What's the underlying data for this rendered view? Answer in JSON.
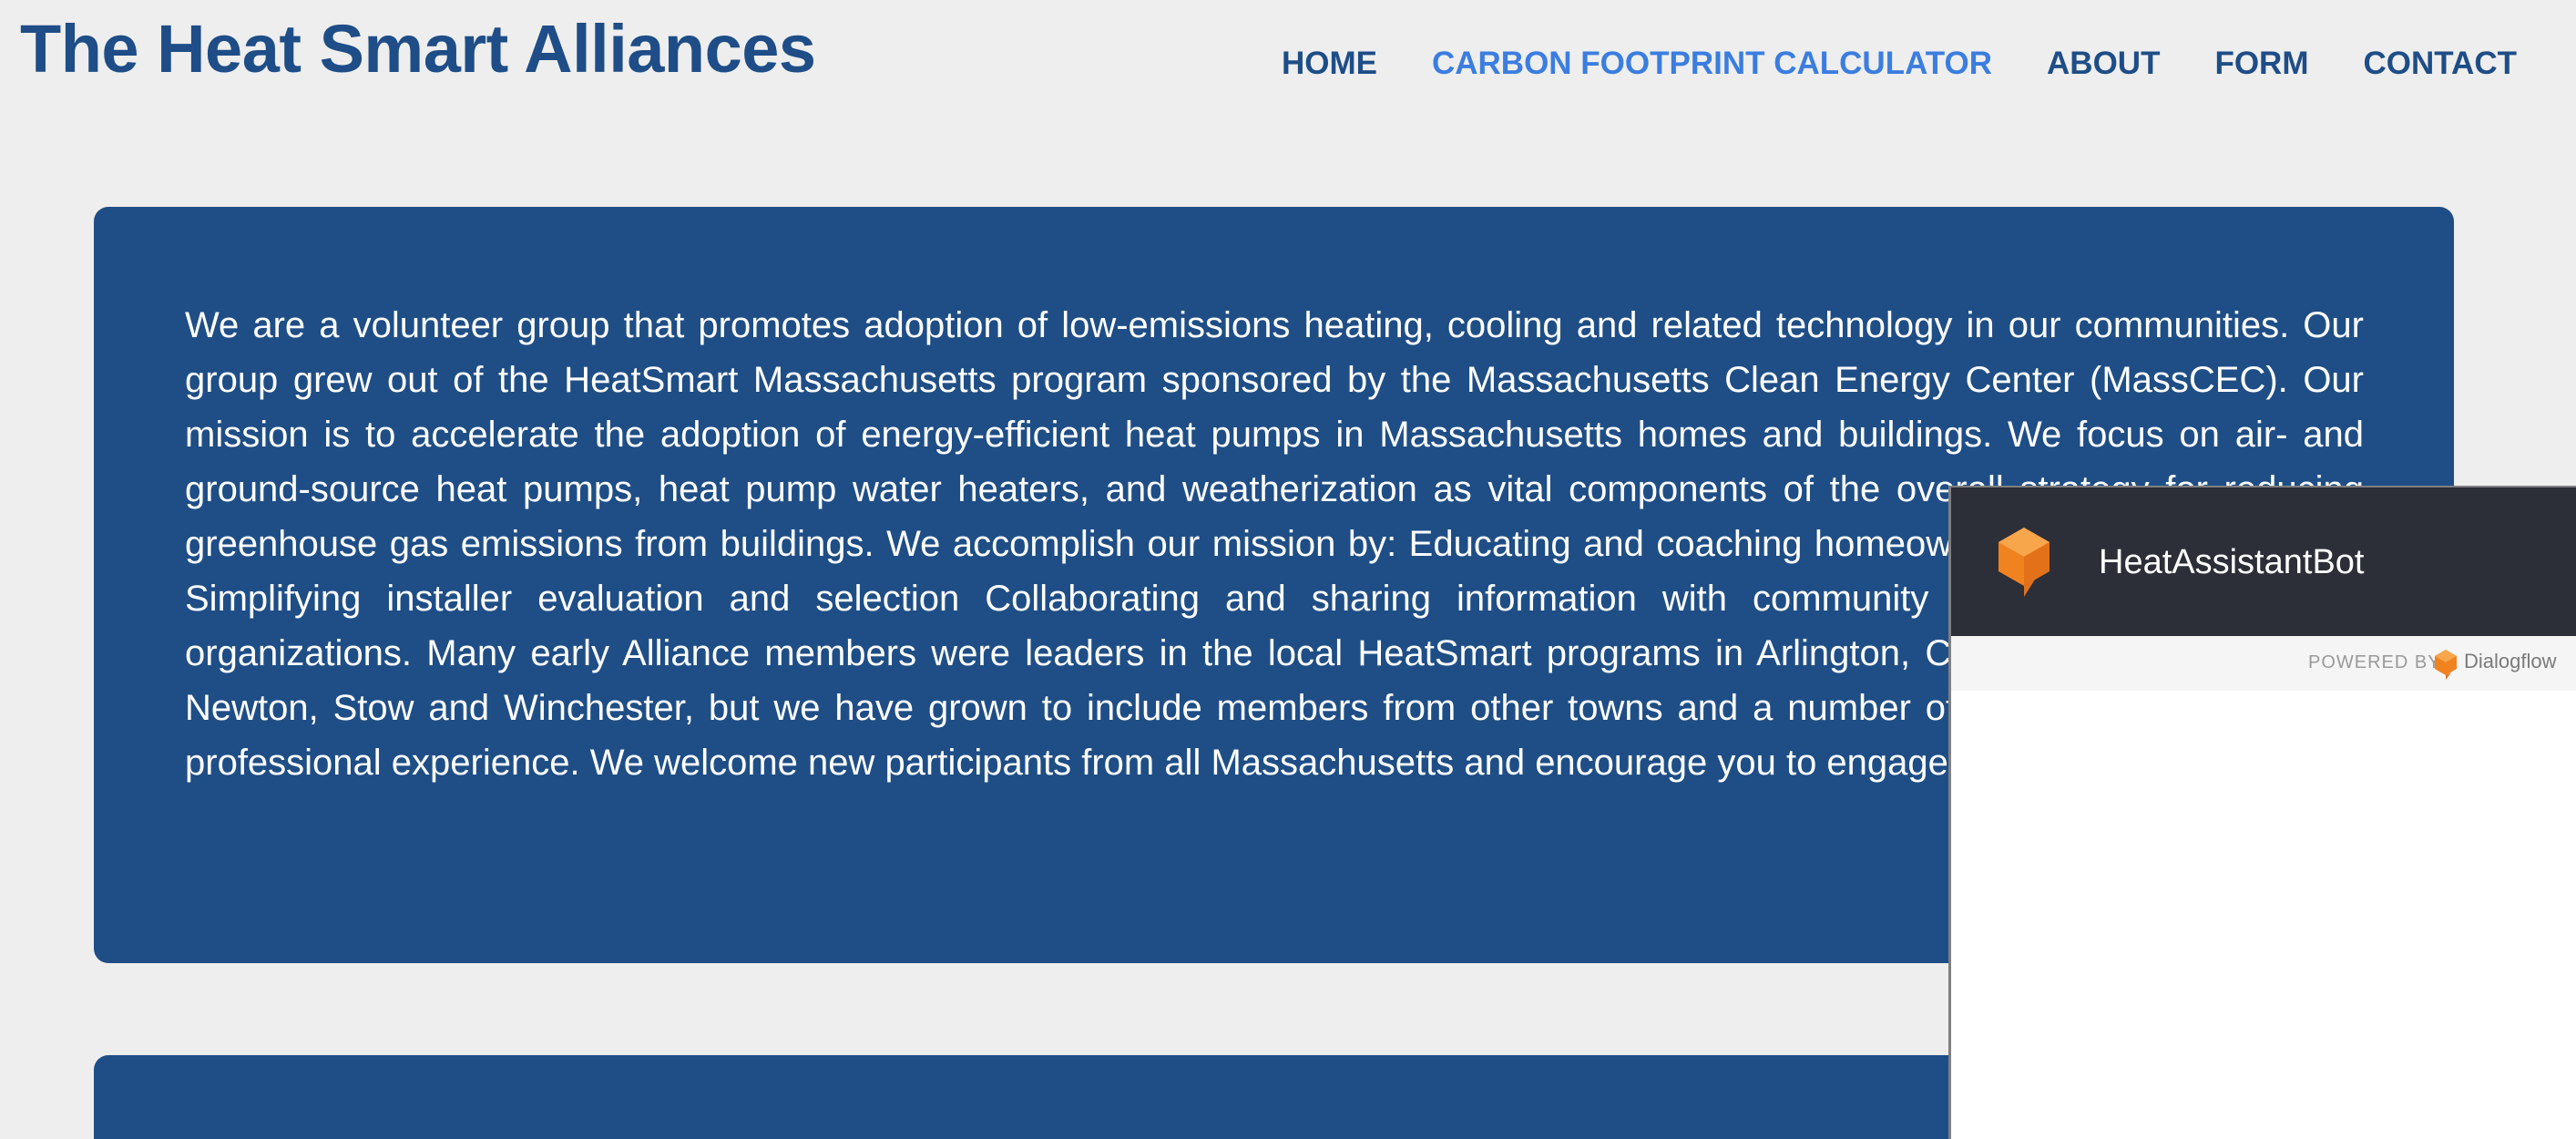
{
  "site": {
    "title": "The Heat Smart Alliances"
  },
  "nav": {
    "items": [
      {
        "label": "HOME"
      },
      {
        "label": "CARBON FOOTPRINT CALCULATOR",
        "active": true
      },
      {
        "label": "ABOUT"
      },
      {
        "label": "FORM"
      },
      {
        "label": "CONTACT"
      }
    ]
  },
  "main": {
    "intro_text": "We are a volunteer group that promotes adoption of low-emissions heating, cooling and related technology in our communities. Our group grew out of the HeatSmart Massachusetts program sponsored by the Massachusetts Clean Energy Center (MassCEC). Our mission is to accelerate the adoption of energy-efficient heat pumps in Massachusetts homes and buildings. We focus on air- and ground-source heat pumps, heat pump water heaters, and weatherization as vital components of the overall strategy for reducing greenhouse gas emissions from buildings. We accomplish our mission by: Educating and coaching homeowners and building owners Simplifying installer evaluation and selection Collaborating and sharing information with community groups and like-minded organizations. Many early Alliance members were leaders in the local HeatSmart programs in Arlington, Concord, Hudson, Lincoln, Newton, Stow and Winchester, but we have grown to include members from other towns and a number of individuals with relevant professional experience. We welcome new participants from all Massachusetts and encourage you to engage with us."
  },
  "chat_widget": {
    "bot_name": "HeatAssistantBot",
    "powered_by": "POWERED BY",
    "provider": "Dialogflow",
    "icons": {
      "bot_logo": "dialogflow-cube-icon",
      "provider_logo": "dialogflow-logo-icon"
    }
  },
  "colors": {
    "brand": "#1e4d87",
    "active_link": "#3b7de0",
    "card_bg": "#1f4e86",
    "chat_header": "#2c2f38",
    "logo_orange": "#f0821f"
  }
}
